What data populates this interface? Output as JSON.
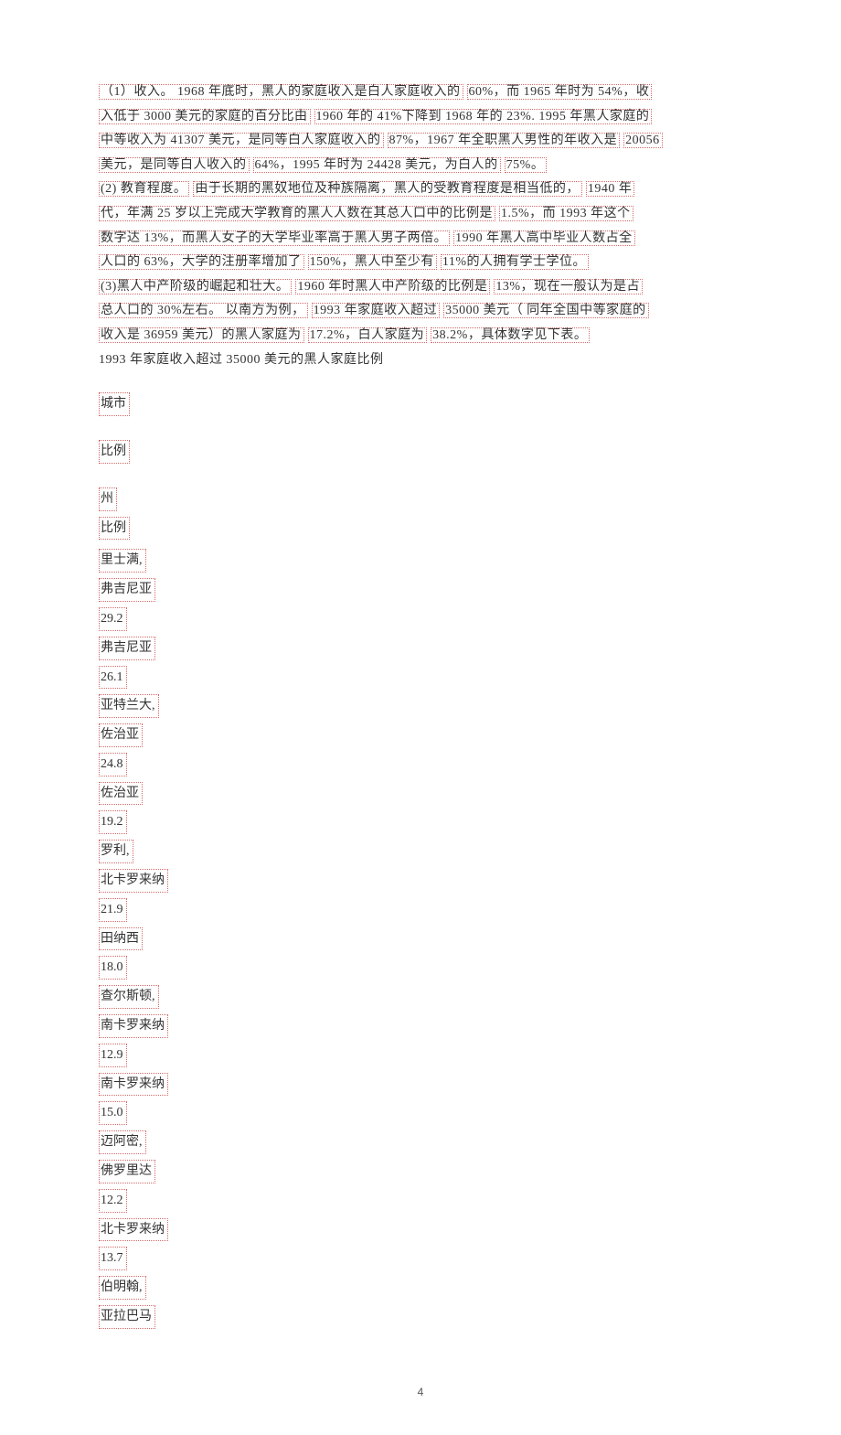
{
  "paragraphs": {
    "p1": [
      "（1）收入。 1968 年底时，黑人的家庭收入是白人家庭收入的",
      "60%，而 1965 年时为 54%，收",
      "入低于 3000 美元的家庭的百分比由",
      "1960 年的 41%下降到 1968 年的 23%. 1995 年黑人家庭的",
      "中等收入为 41307 美元，是同等白人家庭收入的",
      "87%，1967 年全职黑人男性的年收入是",
      "20056",
      "美元，是同等白人收入的",
      "64%，1995 年时为 24428 美元，为白人的",
      "75%。"
    ],
    "p2": [
      "(2) 教育程度。",
      "由于长期的黑奴地位及种族隔离，黑人的受教育程度是相当低的，",
      "1940 年",
      "代，年满 25 岁以上完成大学教育的黑人人数在其总人口中的比例是",
      "1.5%，而 1993 年这个",
      "数字达 13%，而黑人女子的大学毕业率高于黑人男子两倍。",
      "1990 年黑人高中毕业人数占全",
      "人口的 63%，大学的注册率增加了",
      "150%，黑人中至少有",
      "11%的人拥有学士学位。"
    ],
    "p3": [
      "(3)黑人中产阶级的崛起和壮大。",
      "1960 年时黑人中产阶级的比例是",
      "13%，现在一般认为是占",
      "总人口的 30%左右。 以南方为例，",
      "1993 年家庭收入超过",
      "35000 美元（ 同年全国中等家庭的",
      "收入是 36959 美元）的黑人家庭为",
      "17.2%，白人家庭为",
      "38.2%，具体数字见下表。"
    ],
    "p4": "1993 年家庭收入超过   35000 美元的黑人家庭比例"
  },
  "headers": {
    "city": "城市",
    "ratio": "比例",
    "state": "州",
    "ratio2": "比例"
  },
  "list": [
    "里士满,",
    "弗吉尼亚",
    "29.2",
    "弗吉尼亚",
    "26.1",
    "亚特兰大,",
    "佐治亚",
    "24.8",
    "佐治亚",
    "19.2",
    "罗利,",
    "北卡罗来纳",
    "21.9",
    "田纳西",
    "18.0",
    "查尔斯顿,",
    "南卡罗来纳",
    "12.9",
    "南卡罗来纳",
    "15.0",
    "迈阿密,",
    "佛罗里达",
    "12.2",
    "北卡罗来纳",
    "13.7",
    "伯明翰,",
    "亚拉巴马"
  ],
  "page_number": "4"
}
